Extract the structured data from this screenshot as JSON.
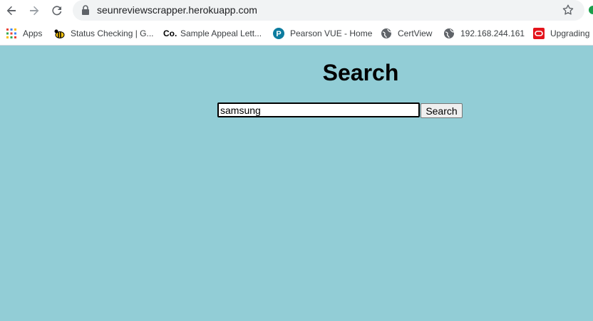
{
  "browser": {
    "url": "seunreviewscrapper.herokuapp.com",
    "bookmarks": [
      {
        "label": "Apps",
        "icon": "apps-grid-icon"
      },
      {
        "label": "Status Checking | G...",
        "icon": "bee-icon"
      },
      {
        "label": "Sample Appeal Lett...",
        "icon": "co-icon"
      },
      {
        "label": "Pearson VUE - Home",
        "icon": "pearson-icon"
      },
      {
        "label": "CertView",
        "icon": "globe-icon"
      },
      {
        "label": "192.168.244.161",
        "icon": "globe-icon"
      },
      {
        "label": "Upgrading",
        "icon": "oracle-icon"
      }
    ]
  },
  "page": {
    "title": "Search",
    "search_value": "samsung",
    "search_button": "Search",
    "background": "#92cdd6"
  }
}
